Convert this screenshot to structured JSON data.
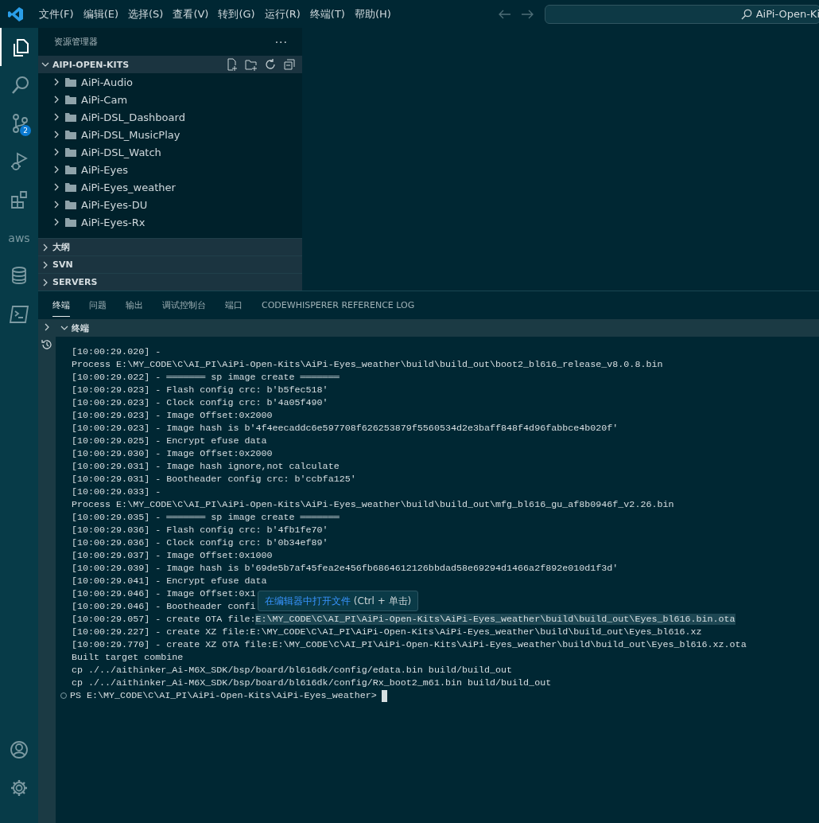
{
  "title_bar": {
    "menus": [
      "文件(F)",
      "编辑(E)",
      "选择(S)",
      "查看(V)",
      "转到(G)",
      "运行(R)",
      "终端(T)",
      "帮助(H)"
    ],
    "search": {
      "value": "AiPi-Open-Ki"
    }
  },
  "activity_bar": {
    "items": [
      {
        "kind": "files",
        "selected": true
      },
      {
        "kind": "search",
        "selected": false
      },
      {
        "kind": "scm",
        "selected": false,
        "badge": "2"
      },
      {
        "kind": "debug",
        "selected": false
      },
      {
        "kind": "extensions",
        "selected": false
      },
      {
        "kind": "aws",
        "selected": false,
        "label": "aws"
      },
      {
        "kind": "database",
        "selected": false
      },
      {
        "kind": "terminal",
        "selected": false
      }
    ],
    "bottom": [
      {
        "kind": "account"
      },
      {
        "kind": "settings"
      }
    ]
  },
  "sidebar": {
    "title": "资源管理器",
    "more": "···",
    "project": {
      "label": "AIPI-OPEN-KITS",
      "expanded": true,
      "children": [
        {
          "label": "AiPi-Audio",
          "expanded": false
        },
        {
          "label": "AiPi-Cam",
          "expanded": false
        },
        {
          "label": "AiPi-DSL_Dashboard",
          "expanded": false
        },
        {
          "label": "AiPi-DSL_MusicPlay",
          "expanded": false
        },
        {
          "label": "AiPi-DSL_Watch",
          "expanded": false
        },
        {
          "label": "AiPi-Eyes",
          "expanded": false
        },
        {
          "label": "AiPi-Eyes_weather",
          "expanded": false
        },
        {
          "label": "AiPi-Eyes-DU",
          "expanded": false
        },
        {
          "label": "AiPi-Eyes-Rx",
          "expanded": false
        }
      ]
    },
    "sections": [
      {
        "label": "大纲",
        "expanded": false
      },
      {
        "label": "SVN",
        "expanded": false
      },
      {
        "label": "SERVERS",
        "expanded": false
      }
    ]
  },
  "panel": {
    "tabs": [
      {
        "label": "终端",
        "selected": true
      },
      {
        "label": "问题",
        "selected": false
      },
      {
        "label": "输出",
        "selected": false
      },
      {
        "label": "调试控制台",
        "selected": false
      },
      {
        "label": "端口",
        "selected": false
      },
      {
        "label": "CODEWHISPERER REFERENCE LOG",
        "selected": false
      }
    ],
    "terminal_header": {
      "label": "终端",
      "expanded": true
    },
    "lines": [
      {
        "text": "[10:00:29.020] -"
      },
      {
        "text": "Process E:\\MY_CODE\\C\\AI_PI\\AiPi-Open-Kits\\AiPi-Eyes_weather\\build\\build_out\\boot2_bl616_release_v8.0.8.bin"
      },
      {
        "text": "[10:00:29.022] - ═══════ sp image create ═══════"
      },
      {
        "text": "[10:00:29.023] - Flash config crc: b'b5fec518'"
      },
      {
        "text": "[10:00:29.023] - Clock config crc: b'4a05f490'"
      },
      {
        "text": "[10:00:29.023] - Image Offset:0x2000"
      },
      {
        "text": "[10:00:29.023] - Image hash is b'4f4eecaddc6e597708f626253879f5560534d2e3baff848f4d96fabbce4b020f'"
      },
      {
        "text": "[10:00:29.025] - Encrypt efuse data"
      },
      {
        "text": "[10:00:29.030] - Image Offset:0x2000"
      },
      {
        "text": "[10:00:29.031] - Image hash ignore,not calculate"
      },
      {
        "text": "[10:00:29.031] - Bootheader config crc: b'ccbfa125'"
      },
      {
        "text": "[10:00:29.033] -"
      },
      {
        "text": "Process E:\\MY_CODE\\C\\AI_PI\\AiPi-Open-Kits\\AiPi-Eyes_weather\\build\\build_out\\mfg_bl616_gu_af8b0946f_v2.26.bin"
      },
      {
        "text": "[10:00:29.035] - ═══════ sp image create ═══════"
      },
      {
        "text": "[10:00:29.036] - Flash config crc: b'4fb1fe70'"
      },
      {
        "text": "[10:00:29.036] - Clock config crc: b'0b34ef89'"
      },
      {
        "text": "[10:00:29.037] - Image Offset:0x1000"
      },
      {
        "text": "[10:00:29.039] - Image hash is b'69de5b7af45fea2e456fb6864612126bbdad58e69294d1466a2f892e010d1f3d'"
      },
      {
        "text": "[10:00:29.041] - Encrypt efuse data"
      },
      {
        "text": "[10:00:29.046] - Image Offset:0x1"
      },
      {
        "text": "[10:00:29.046] - Bootheader confi"
      },
      {
        "text": "[10:00:29.057] - create OTA file:",
        "link": "E:\\MY_CODE\\C\\AI_PI\\AiPi-Open-Kits\\AiPi-Eyes_weather\\build\\build_out\\Eyes_bl616.bin.ota"
      },
      {
        "text": "[10:00:29.227] - create XZ file:E:\\MY_CODE\\C\\AI_PI\\AiPi-Open-Kits\\AiPi-Eyes_weather\\build\\build_out\\Eyes_bl616.xz"
      },
      {
        "text": "[10:00:29.770] - create XZ OTA file:E:\\MY_CODE\\C\\AI_PI\\AiPi-Open-Kits\\AiPi-Eyes_weather\\build\\build_out\\Eyes_bl616.xz.ota"
      },
      {
        "text": "Built target combine"
      },
      {
        "text": "cp ./../aithinker_Ai-M6X_SDK/bsp/board/bl616dk/config/edata.bin build/build_out"
      },
      {
        "text": "cp ./../aithinker_Ai-M6X_SDK/bsp/board/bl616dk/config/Rx_boot2_m61.bin build/build_out"
      }
    ],
    "prompt": "PS E:\\MY_CODE\\C\\AI_PI\\AiPi-Open-Kits\\AiPi-Eyes_weather>",
    "tooltip": {
      "link": "在编辑器中打开文件",
      "hint": "(Ctrl + 单击)"
    }
  }
}
